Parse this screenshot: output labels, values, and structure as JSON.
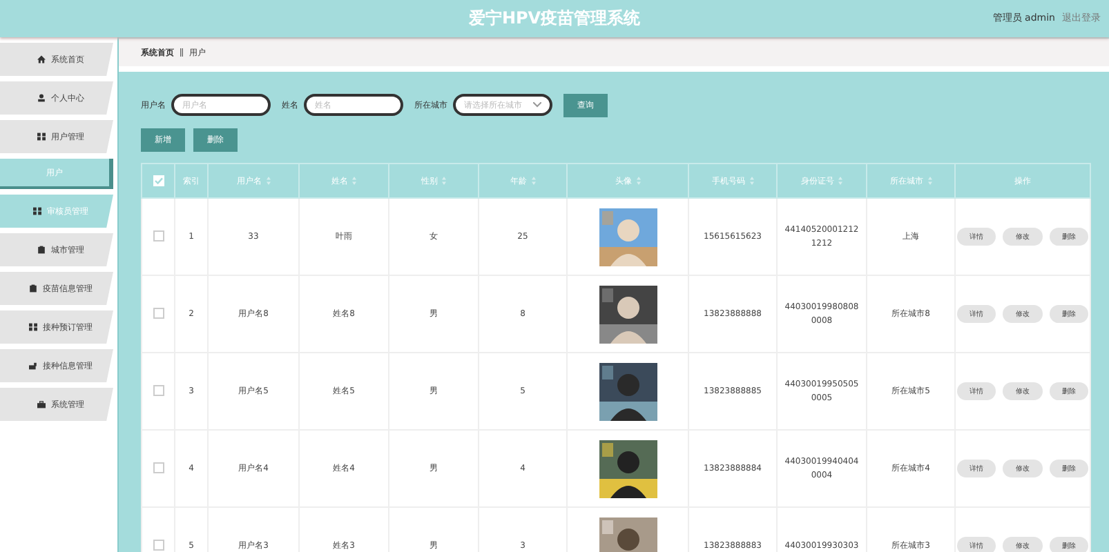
{
  "header": {
    "title": "爱宁HPV疫苗管理系统",
    "user": "管理员 admin",
    "logout": "退出登录"
  },
  "sidebar": {
    "items": [
      {
        "label": "系统首页",
        "hovered": false
      },
      {
        "label": "个人中心",
        "hovered": false
      },
      {
        "label": "用户管理",
        "hovered": false,
        "children": [
          {
            "label": "用户",
            "selected": true
          }
        ]
      },
      {
        "label": "审核员管理",
        "hovered": true
      },
      {
        "label": "城市管理",
        "hovered": false
      },
      {
        "label": "疫苗信息管理",
        "hovered": false
      },
      {
        "label": "接种预订管理",
        "hovered": false
      },
      {
        "label": "接种信息管理",
        "hovered": false
      },
      {
        "label": "系统管理",
        "hovered": false
      }
    ]
  },
  "breadcrumb": [
    "系统首页",
    "用户"
  ],
  "search": {
    "fields": [
      {
        "label": "用户名",
        "placeholder": "用户名",
        "kind": "input"
      },
      {
        "label": "姓名",
        "placeholder": "姓名",
        "kind": "input"
      },
      {
        "label": "所在城市",
        "placeholder": "请选择所在城市",
        "kind": "select"
      }
    ],
    "button": "查询"
  },
  "actions": [
    "新增",
    "删除"
  ],
  "table": {
    "select_all": {
      "checked": true
    },
    "columns": [
      {
        "label": "索引",
        "sortable": false
      },
      {
        "label": "用户名",
        "sortable": true
      },
      {
        "label": "姓名",
        "sortable": true
      },
      {
        "label": "性别",
        "sortable": true
      },
      {
        "label": "年龄",
        "sortable": true
      },
      {
        "label": "头像",
        "sortable": true
      },
      {
        "label": "手机号码",
        "sortable": true
      },
      {
        "label": "身份证号",
        "sortable": true
      },
      {
        "label": "所在城市",
        "sortable": true
      },
      {
        "label": "操作",
        "sortable": false
      }
    ],
    "rows": [
      {
        "checked": false,
        "cells": [
          "1",
          "33",
          "叶雨",
          "女",
          "25",
          {
            "kind": "picture"
          },
          "15615615623",
          "441405200012121212",
          "上海"
        ],
        "buttons": [
          "详情",
          "修改",
          "删除"
        ]
      },
      {
        "checked": false,
        "cells": [
          "2",
          "用户名8",
          "姓名8",
          "男",
          "8",
          {
            "kind": "picture"
          },
          "13823888888",
          "440300199808080008",
          "所在城市8"
        ],
        "buttons": [
          "详情",
          "修改",
          "删除"
        ]
      },
      {
        "checked": false,
        "cells": [
          "3",
          "用户名5",
          "姓名5",
          "男",
          "5",
          {
            "kind": "picture"
          },
          "13823888885",
          "440300199505050005",
          "所在城市5"
        ],
        "buttons": [
          "详情",
          "修改",
          "删除"
        ]
      },
      {
        "checked": false,
        "cells": [
          "4",
          "用户名4",
          "姓名4",
          "男",
          "4",
          {
            "kind": "picture"
          },
          "13823888884",
          "440300199404040004",
          "所在城市4"
        ],
        "buttons": [
          "详情",
          "修改",
          "删除"
        ]
      },
      {
        "checked": false,
        "cells": [
          "5",
          "用户名3",
          "姓名3",
          "男",
          "3",
          {
            "kind": "picture"
          },
          "13823888883",
          "44030019930303",
          "所在城市3"
        ],
        "buttons": [
          "详情",
          "修改",
          "删除"
        ]
      }
    ]
  }
}
